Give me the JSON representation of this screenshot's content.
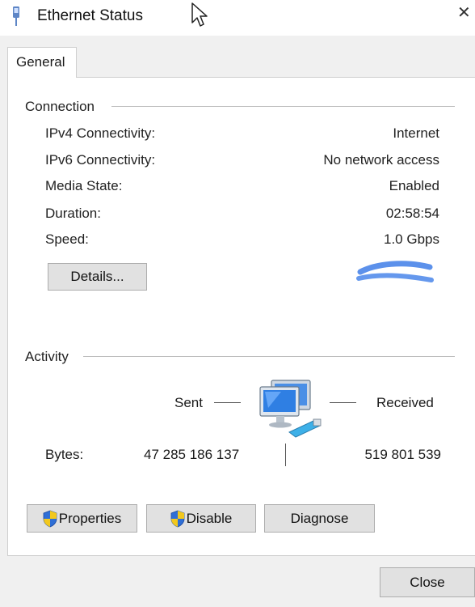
{
  "window": {
    "title": "Ethernet Status",
    "close_glyph": "✕"
  },
  "tabs": [
    {
      "label": "General"
    }
  ],
  "connection": {
    "heading": "Connection",
    "rows": [
      {
        "label": "IPv4 Connectivity:",
        "value": "Internet"
      },
      {
        "label": "IPv6 Connectivity:",
        "value": "No network access"
      },
      {
        "label": "Media State:",
        "value": "Enabled"
      },
      {
        "label": "Duration:",
        "value": "02:58:54"
      },
      {
        "label": "Speed:",
        "value": "1.0 Gbps"
      }
    ],
    "details_label": "Details..."
  },
  "activity": {
    "heading": "Activity",
    "sent_label": "Sent",
    "received_label": "Received",
    "bytes_label": "Bytes:",
    "bytes_sent": "47 285 186 137",
    "bytes_received": "519 801 539",
    "network_icon": "network-computers-icon"
  },
  "buttons": {
    "properties": "Properties",
    "disable": "Disable",
    "diagnose": "Diagnose",
    "close": "Close"
  },
  "colors": {
    "shield_blue": "#2f6fd6",
    "shield_yellow": "#f2c81e",
    "smudge_blue": "#3f7ee8"
  }
}
